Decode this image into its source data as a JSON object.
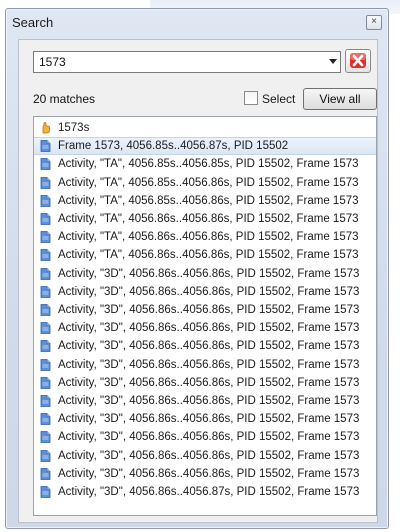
{
  "window": {
    "title": "Search"
  },
  "search": {
    "value": "1573"
  },
  "toolbar": {
    "matches_label": "20 matches",
    "select_label": "Select",
    "view_all_label": "View all"
  },
  "results": [
    {
      "label": "1573s",
      "icon": "hand-icon"
    },
    {
      "label": "Frame 1573, 4056.85s..4056.87s, PID 15502",
      "icon": "document-icon"
    },
    {
      "label": "Activity, \"TA\", 4056.85s..4056.85s, PID 15502, Frame 1573",
      "icon": "document-icon"
    },
    {
      "label": "Activity, \"TA\", 4056.85s..4056.86s, PID 15502, Frame 1573",
      "icon": "document-icon"
    },
    {
      "label": "Activity, \"TA\", 4056.85s..4056.86s, PID 15502, Frame 1573",
      "icon": "document-icon"
    },
    {
      "label": "Activity, \"TA\", 4056.86s..4056.86s, PID 15502, Frame 1573",
      "icon": "document-icon"
    },
    {
      "label": "Activity, \"TA\", 4056.86s..4056.86s, PID 15502, Frame 1573",
      "icon": "document-icon"
    },
    {
      "label": "Activity, \"TA\", 4056.86s..4056.86s, PID 15502, Frame 1573",
      "icon": "document-icon"
    },
    {
      "label": "Activity, \"3D\", 4056.86s..4056.86s, PID 15502, Frame 1573",
      "icon": "document-icon"
    },
    {
      "label": "Activity, \"3D\", 4056.86s..4056.86s, PID 15502, Frame 1573",
      "icon": "document-icon"
    },
    {
      "label": "Activity, \"3D\", 4056.86s..4056.86s, PID 15502, Frame 1573",
      "icon": "document-icon"
    },
    {
      "label": "Activity, \"3D\", 4056.86s..4056.86s, PID 15502, Frame 1573",
      "icon": "document-icon"
    },
    {
      "label": "Activity, \"3D\", 4056.86s..4056.86s, PID 15502, Frame 1573",
      "icon": "document-icon"
    },
    {
      "label": "Activity, \"3D\", 4056.86s..4056.86s, PID 15502, Frame 1573",
      "icon": "document-icon"
    },
    {
      "label": "Activity, \"3D\", 4056.86s..4056.86s, PID 15502, Frame 1573",
      "icon": "document-icon"
    },
    {
      "label": "Activity, \"3D\", 4056.86s..4056.86s, PID 15502, Frame 1573",
      "icon": "document-icon"
    },
    {
      "label": "Activity, \"3D\", 4056.86s..4056.86s, PID 15502, Frame 1573",
      "icon": "document-icon"
    },
    {
      "label": "Activity, \"3D\", 4056.86s..4056.86s, PID 15502, Frame 1573",
      "icon": "document-icon"
    },
    {
      "label": "Activity, \"3D\", 4056.86s..4056.86s, PID 15502, Frame 1573",
      "icon": "document-icon"
    },
    {
      "label": "Activity, \"3D\", 4056.86s..4056.86s, PID 15502, Frame 1573",
      "icon": "document-icon"
    },
    {
      "label": "Activity, \"3D\", 4056.86s..4056.87s, PID 15502, Frame 1573",
      "icon": "document-icon"
    }
  ],
  "selected_index": 1,
  "colors": {
    "selection": "#dbe6f4",
    "clear_red": "#d9332b",
    "icon_blue": "#4f86d3"
  }
}
